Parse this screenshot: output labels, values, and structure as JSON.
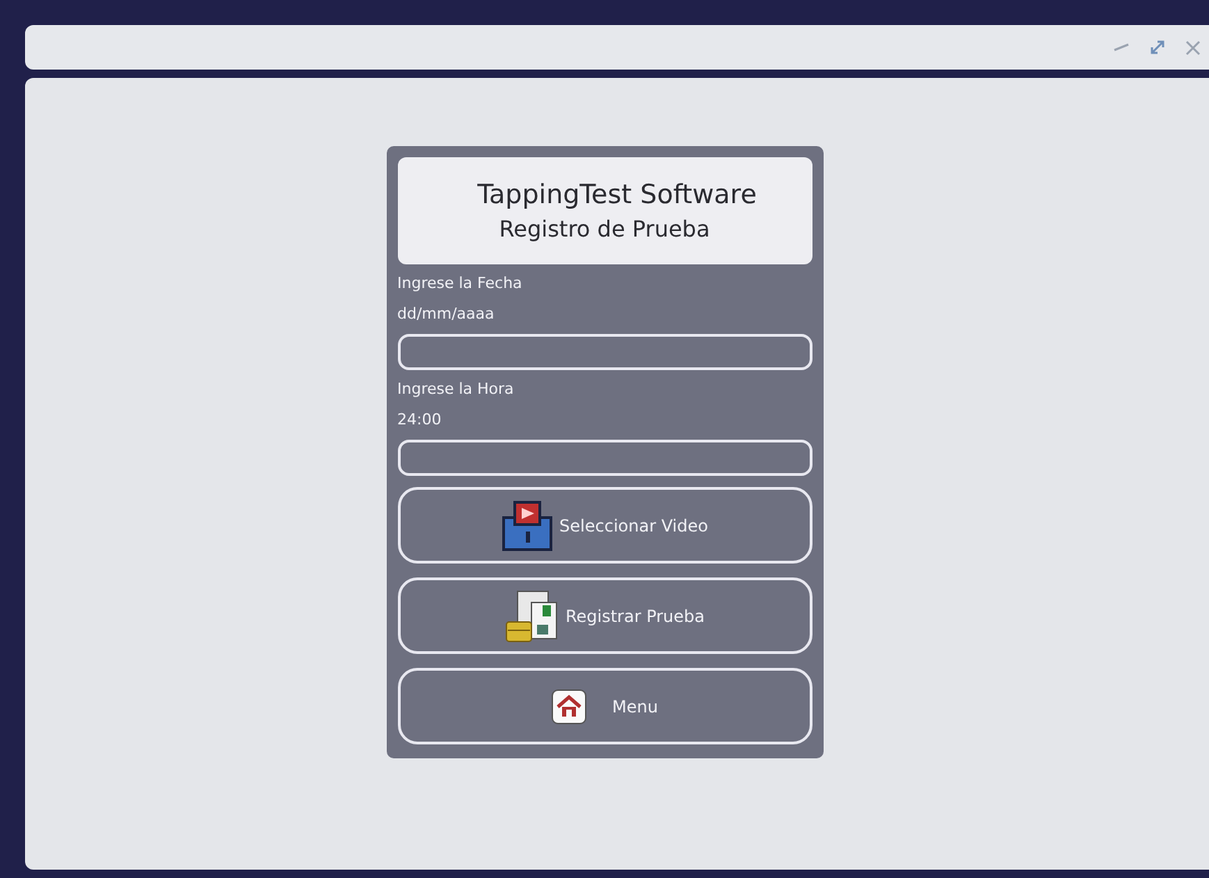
{
  "header": {
    "title": "TappingTest Software",
    "subtitle": "Registro de Prueba"
  },
  "fields": [
    {
      "label": "Ingrese la Fecha",
      "hint": "dd/mm/aaaa"
    },
    {
      "label": "Ingrese la Hora",
      "hint": "24:00"
    }
  ],
  "buttons": [
    {
      "label": "Seleccionar Video",
      "kind": "video"
    },
    {
      "label": "Registrar Prueba",
      "kind": "register"
    },
    {
      "label": "Menu",
      "kind": "home"
    }
  ]
}
